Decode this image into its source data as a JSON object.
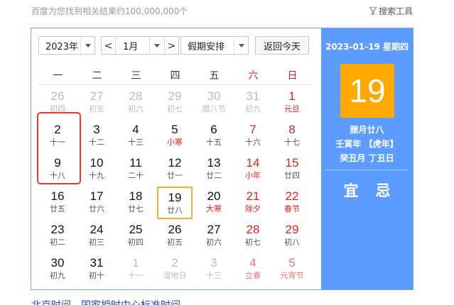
{
  "header": {
    "result_count": "百度为您找到相关结果约100,000,000个",
    "search_tools": "搜索工具",
    "filter_icon": "funnel-icon"
  },
  "controls": {
    "year": "2023年",
    "month": "1月",
    "holiday": "假期安排",
    "prev": "<",
    "next": ">",
    "today": "返回今天"
  },
  "weekdays": [
    "一",
    "二",
    "三",
    "四",
    "五",
    "六",
    "日"
  ],
  "days": [
    {
      "d": "26",
      "l": "初四",
      "o": true
    },
    {
      "d": "27",
      "l": "初五",
      "o": true
    },
    {
      "d": "28",
      "l": "初六",
      "o": true
    },
    {
      "d": "29",
      "l": "初七",
      "o": true
    },
    {
      "d": "30",
      "l": "腊八节",
      "o": true
    },
    {
      "d": "31",
      "l": "初九",
      "o": true
    },
    {
      "d": "1",
      "l": "元旦",
      "h": true
    },
    {
      "d": "2",
      "l": "十一"
    },
    {
      "d": "3",
      "l": "十二"
    },
    {
      "d": "4",
      "l": "十三"
    },
    {
      "d": "5",
      "l": "小寒",
      "h": true
    },
    {
      "d": "6",
      "l": "十五"
    },
    {
      "d": "7",
      "l": "十六"
    },
    {
      "d": "8",
      "l": "十七"
    },
    {
      "d": "9",
      "l": "十八"
    },
    {
      "d": "10",
      "l": "十九"
    },
    {
      "d": "11",
      "l": "二十"
    },
    {
      "d": "12",
      "l": "廿一"
    },
    {
      "d": "13",
      "l": "廿二"
    },
    {
      "d": "14",
      "l": "小年",
      "h": true
    },
    {
      "d": "15",
      "l": "廿四"
    },
    {
      "d": "16",
      "l": "廿五"
    },
    {
      "d": "17",
      "l": "廿六"
    },
    {
      "d": "18",
      "l": "廿七"
    },
    {
      "d": "19",
      "l": "廿八",
      "t": true
    },
    {
      "d": "20",
      "l": "大寒",
      "h": true
    },
    {
      "d": "21",
      "l": "除夕",
      "h": true
    },
    {
      "d": "22",
      "l": "春节",
      "h": true
    },
    {
      "d": "23",
      "l": "初二"
    },
    {
      "d": "24",
      "l": "初三"
    },
    {
      "d": "25",
      "l": "初四"
    },
    {
      "d": "26",
      "l": "初五"
    },
    {
      "d": "27",
      "l": "初六"
    },
    {
      "d": "28",
      "l": "初七"
    },
    {
      "d": "29",
      "l": "初八"
    },
    {
      "d": "30",
      "l": "初九"
    },
    {
      "d": "31",
      "l": "初十"
    },
    {
      "d": "1",
      "l": "十一",
      "o": true
    },
    {
      "d": "2",
      "l": "湿地日",
      "o": true
    },
    {
      "d": "3",
      "l": "十三",
      "o": true
    },
    {
      "d": "4",
      "l": "立春",
      "o": true,
      "h": true
    },
    {
      "d": "5",
      "l": "元宵节",
      "o": true,
      "h": true
    }
  ],
  "detail": {
    "date": "2023-01-19 星期四",
    "day": "19",
    "lunar": "腊月廿八",
    "ganzhi_year": "壬寅年 【虎年】",
    "ganzhi_month_day": "癸丑月 丁丑日",
    "yi": "宜",
    "ji": "忌"
  },
  "bottom_link": "北京时间 - 国家授时中心标准时间",
  "colors": {
    "accent_blue": "#5c9cff",
    "today_orange": "#ffa900",
    "holiday_red": "#e02020",
    "selection_red": "#e53935"
  }
}
